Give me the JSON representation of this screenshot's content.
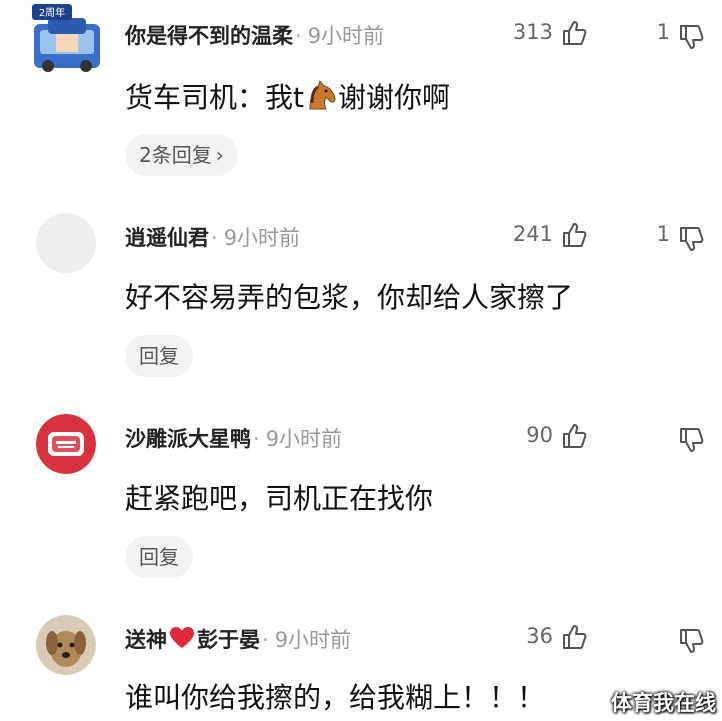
{
  "comments": [
    {
      "username": "你是得不到的温柔",
      "time": "9小时前",
      "likes": "313",
      "dislikes": "1",
      "content_before": "货车司机：我t",
      "content_after": "谢谢你啊",
      "inline_icon": "horse-emoji-icon",
      "reply_label": "2条回复",
      "reply_chevron": "›",
      "avatar_badge": "2周年",
      "avatar_icon": "vehicle-avatar-icon"
    },
    {
      "username": "逍遥仙君",
      "time": "9小时前",
      "likes": "241",
      "dislikes": "1",
      "content": "好不容易弄的包浆，你却给人家擦了",
      "reply_label": "回复",
      "avatar_icon": "blank-avatar"
    },
    {
      "username": "沙雕派大星鸭",
      "time": "9小时前",
      "likes": "90",
      "dislikes": "",
      "content": "赶紧跑吧，司机正在找你",
      "reply_label": "回复",
      "avatar_icon": "red-badge-avatar"
    },
    {
      "username_before": "送神",
      "username_after": "彭于晏",
      "username_icon": "heart-icon",
      "time": "9小时前",
      "likes": "36",
      "dislikes": "",
      "content": "谁叫你给我擦的，给我糊上！！！",
      "avatar_icon": "dog-avatar-icon"
    }
  ],
  "watermark": "体育我在线",
  "colors": {
    "heart": "#e0283a",
    "avatar_red": "#d9323f",
    "avatar_blank": "#eeeeee"
  }
}
